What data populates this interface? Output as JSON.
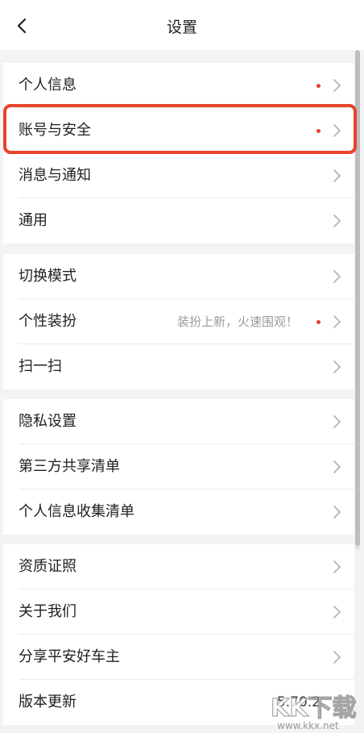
{
  "header": {
    "title": "设置"
  },
  "groups": [
    {
      "rows": [
        {
          "label": "个人信息",
          "dot": true
        },
        {
          "label": "账号与安全",
          "dot": true,
          "highlighted": true
        },
        {
          "label": "消息与通知"
        },
        {
          "label": "通用"
        }
      ]
    },
    {
      "rows": [
        {
          "label": "切换模式"
        },
        {
          "label": "个性装扮",
          "hint": "装扮上新，火速围观！",
          "dot": true
        },
        {
          "label": "扫一扫"
        }
      ]
    },
    {
      "rows": [
        {
          "label": "隐私设置"
        },
        {
          "label": "第三方共享清单"
        },
        {
          "label": "个人信息收集清单"
        }
      ]
    },
    {
      "rows": [
        {
          "label": "资质证照"
        },
        {
          "label": "关于我们"
        },
        {
          "label": "分享平安好车主"
        },
        {
          "label": "版本更新",
          "value": "5.70.2"
        }
      ]
    }
  ],
  "watermark": {
    "logo": "KK下载",
    "site": "www.kkx.net"
  },
  "colors": {
    "accent_dot": "#e63e30",
    "highlight_border": "#e8432c",
    "group_gap": "#f3f3f3"
  }
}
